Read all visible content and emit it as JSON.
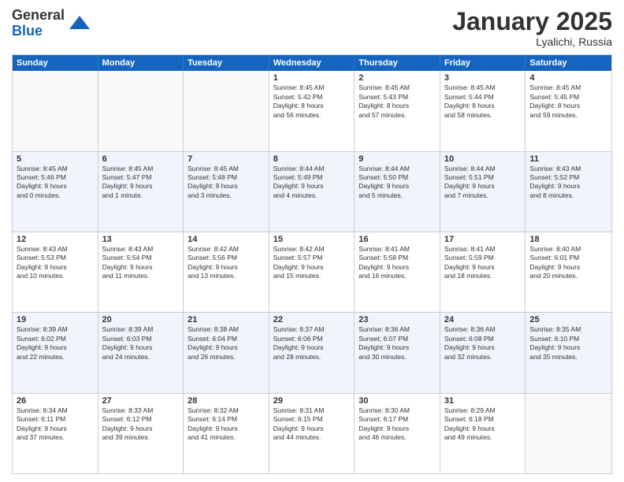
{
  "logo": {
    "general": "General",
    "blue": "Blue"
  },
  "title": "January 2025",
  "location": "Lyalichi, Russia",
  "header_days": [
    "Sunday",
    "Monday",
    "Tuesday",
    "Wednesday",
    "Thursday",
    "Friday",
    "Saturday"
  ],
  "rows": [
    {
      "alt": false,
      "cells": [
        {
          "num": "",
          "info": "",
          "empty": true
        },
        {
          "num": "",
          "info": "",
          "empty": true
        },
        {
          "num": "",
          "info": "",
          "empty": true
        },
        {
          "num": "1",
          "info": "Sunrise: 8:45 AM\nSunset: 5:42 PM\nDaylight: 8 hours\nand 56 minutes.",
          "empty": false
        },
        {
          "num": "2",
          "info": "Sunrise: 8:45 AM\nSunset: 5:43 PM\nDaylight: 8 hours\nand 57 minutes.",
          "empty": false
        },
        {
          "num": "3",
          "info": "Sunrise: 8:45 AM\nSunset: 5:44 PM\nDaylight: 8 hours\nand 58 minutes.",
          "empty": false
        },
        {
          "num": "4",
          "info": "Sunrise: 8:45 AM\nSunset: 5:45 PM\nDaylight: 8 hours\nand 59 minutes.",
          "empty": false
        }
      ]
    },
    {
      "alt": true,
      "cells": [
        {
          "num": "5",
          "info": "Sunrise: 8:45 AM\nSunset: 5:46 PM\nDaylight: 9 hours\nand 0 minutes.",
          "empty": false
        },
        {
          "num": "6",
          "info": "Sunrise: 8:45 AM\nSunset: 5:47 PM\nDaylight: 9 hours\nand 1 minute.",
          "empty": false
        },
        {
          "num": "7",
          "info": "Sunrise: 8:45 AM\nSunset: 5:48 PM\nDaylight: 9 hours\nand 3 minutes.",
          "empty": false
        },
        {
          "num": "8",
          "info": "Sunrise: 8:44 AM\nSunset: 5:49 PM\nDaylight: 9 hours\nand 4 minutes.",
          "empty": false
        },
        {
          "num": "9",
          "info": "Sunrise: 8:44 AM\nSunset: 5:50 PM\nDaylight: 9 hours\nand 5 minutes.",
          "empty": false
        },
        {
          "num": "10",
          "info": "Sunrise: 8:44 AM\nSunset: 5:51 PM\nDaylight: 9 hours\nand 7 minutes.",
          "empty": false
        },
        {
          "num": "11",
          "info": "Sunrise: 8:43 AM\nSunset: 5:52 PM\nDaylight: 9 hours\nand 8 minutes.",
          "empty": false
        }
      ]
    },
    {
      "alt": false,
      "cells": [
        {
          "num": "12",
          "info": "Sunrise: 8:43 AM\nSunset: 5:53 PM\nDaylight: 9 hours\nand 10 minutes.",
          "empty": false
        },
        {
          "num": "13",
          "info": "Sunrise: 8:43 AM\nSunset: 5:54 PM\nDaylight: 9 hours\nand 11 minutes.",
          "empty": false
        },
        {
          "num": "14",
          "info": "Sunrise: 8:42 AM\nSunset: 5:56 PM\nDaylight: 9 hours\nand 13 minutes.",
          "empty": false
        },
        {
          "num": "15",
          "info": "Sunrise: 8:42 AM\nSunset: 5:57 PM\nDaylight: 9 hours\nand 15 minutes.",
          "empty": false
        },
        {
          "num": "16",
          "info": "Sunrise: 8:41 AM\nSunset: 5:58 PM\nDaylight: 9 hours\nand 16 minutes.",
          "empty": false
        },
        {
          "num": "17",
          "info": "Sunrise: 8:41 AM\nSunset: 5:59 PM\nDaylight: 9 hours\nand 18 minutes.",
          "empty": false
        },
        {
          "num": "18",
          "info": "Sunrise: 8:40 AM\nSunset: 6:01 PM\nDaylight: 9 hours\nand 20 minutes.",
          "empty": false
        }
      ]
    },
    {
      "alt": true,
      "cells": [
        {
          "num": "19",
          "info": "Sunrise: 8:39 AM\nSunset: 6:02 PM\nDaylight: 9 hours\nand 22 minutes.",
          "empty": false
        },
        {
          "num": "20",
          "info": "Sunrise: 8:39 AM\nSunset: 6:03 PM\nDaylight: 9 hours\nand 24 minutes.",
          "empty": false
        },
        {
          "num": "21",
          "info": "Sunrise: 8:38 AM\nSunset: 6:04 PM\nDaylight: 9 hours\nand 26 minutes.",
          "empty": false
        },
        {
          "num": "22",
          "info": "Sunrise: 8:37 AM\nSunset: 6:06 PM\nDaylight: 9 hours\nand 28 minutes.",
          "empty": false
        },
        {
          "num": "23",
          "info": "Sunrise: 8:36 AM\nSunset: 6:07 PM\nDaylight: 9 hours\nand 30 minutes.",
          "empty": false
        },
        {
          "num": "24",
          "info": "Sunrise: 8:36 AM\nSunset: 6:08 PM\nDaylight: 9 hours\nand 32 minutes.",
          "empty": false
        },
        {
          "num": "25",
          "info": "Sunrise: 8:35 AM\nSunset: 6:10 PM\nDaylight: 9 hours\nand 35 minutes.",
          "empty": false
        }
      ]
    },
    {
      "alt": false,
      "cells": [
        {
          "num": "26",
          "info": "Sunrise: 8:34 AM\nSunset: 6:11 PM\nDaylight: 9 hours\nand 37 minutes.",
          "empty": false
        },
        {
          "num": "27",
          "info": "Sunrise: 8:33 AM\nSunset: 6:12 PM\nDaylight: 9 hours\nand 39 minutes.",
          "empty": false
        },
        {
          "num": "28",
          "info": "Sunrise: 8:32 AM\nSunset: 6:14 PM\nDaylight: 9 hours\nand 41 minutes.",
          "empty": false
        },
        {
          "num": "29",
          "info": "Sunrise: 8:31 AM\nSunset: 6:15 PM\nDaylight: 9 hours\nand 44 minutes.",
          "empty": false
        },
        {
          "num": "30",
          "info": "Sunrise: 8:30 AM\nSunset: 6:17 PM\nDaylight: 9 hours\nand 46 minutes.",
          "empty": false
        },
        {
          "num": "31",
          "info": "Sunrise: 8:29 AM\nSunset: 6:18 PM\nDaylight: 9 hours\nand 49 minutes.",
          "empty": false
        },
        {
          "num": "",
          "info": "",
          "empty": true
        }
      ]
    }
  ]
}
